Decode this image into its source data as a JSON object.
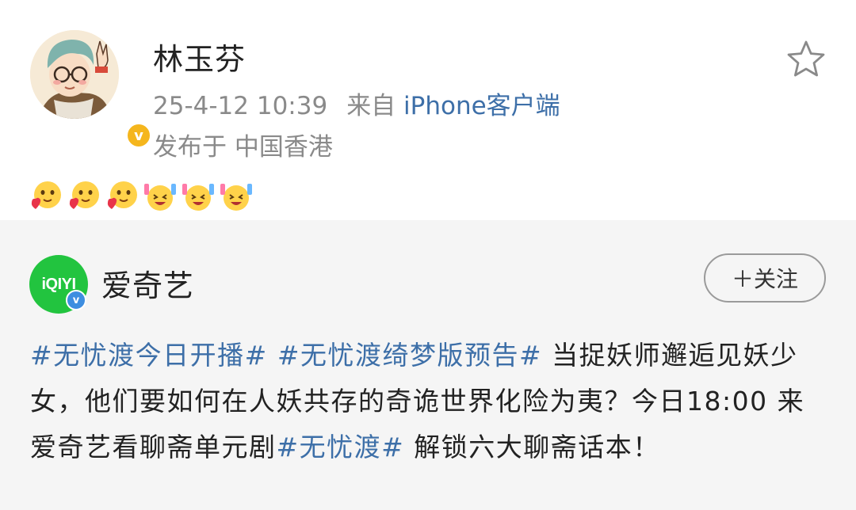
{
  "post": {
    "user_name": "林玉芬",
    "timestamp": "25-4-12 10:39",
    "source_prefix": "来自",
    "source": "iPhone客户端",
    "location": "发布于 中国香港",
    "verified_color": "#f5b61d",
    "emojis": [
      "heart-face-emoji",
      "heart-face-emoji",
      "heart-face-emoji",
      "cheering-face-emoji",
      "cheering-face-emoji",
      "cheering-face-emoji"
    ]
  },
  "repost": {
    "org_name": "爱奇艺",
    "logo_text": "iQIYI",
    "logo_color": "#22c43f",
    "follow_label": "＋关注",
    "text_segments": [
      {
        "text": "#无忧渡今日开播#",
        "type": "hashtag"
      },
      {
        "text": " ",
        "type": "plain"
      },
      {
        "text": "#无忧渡绮梦版预告#",
        "type": "hashtag"
      },
      {
        "text": " 当捉妖师邂逅见妖少女，他们要如何在人妖共存的奇诡世界化险为夷？今日18:00 来爱奇艺看聊斋单元剧",
        "type": "plain"
      },
      {
        "text": "#无忧渡#",
        "type": "hashtag"
      },
      {
        "text": " 解锁六大聊斋话本！",
        "type": "plain"
      }
    ],
    "link_color": "#3d6fa8",
    "background": "#f5f5f5"
  }
}
